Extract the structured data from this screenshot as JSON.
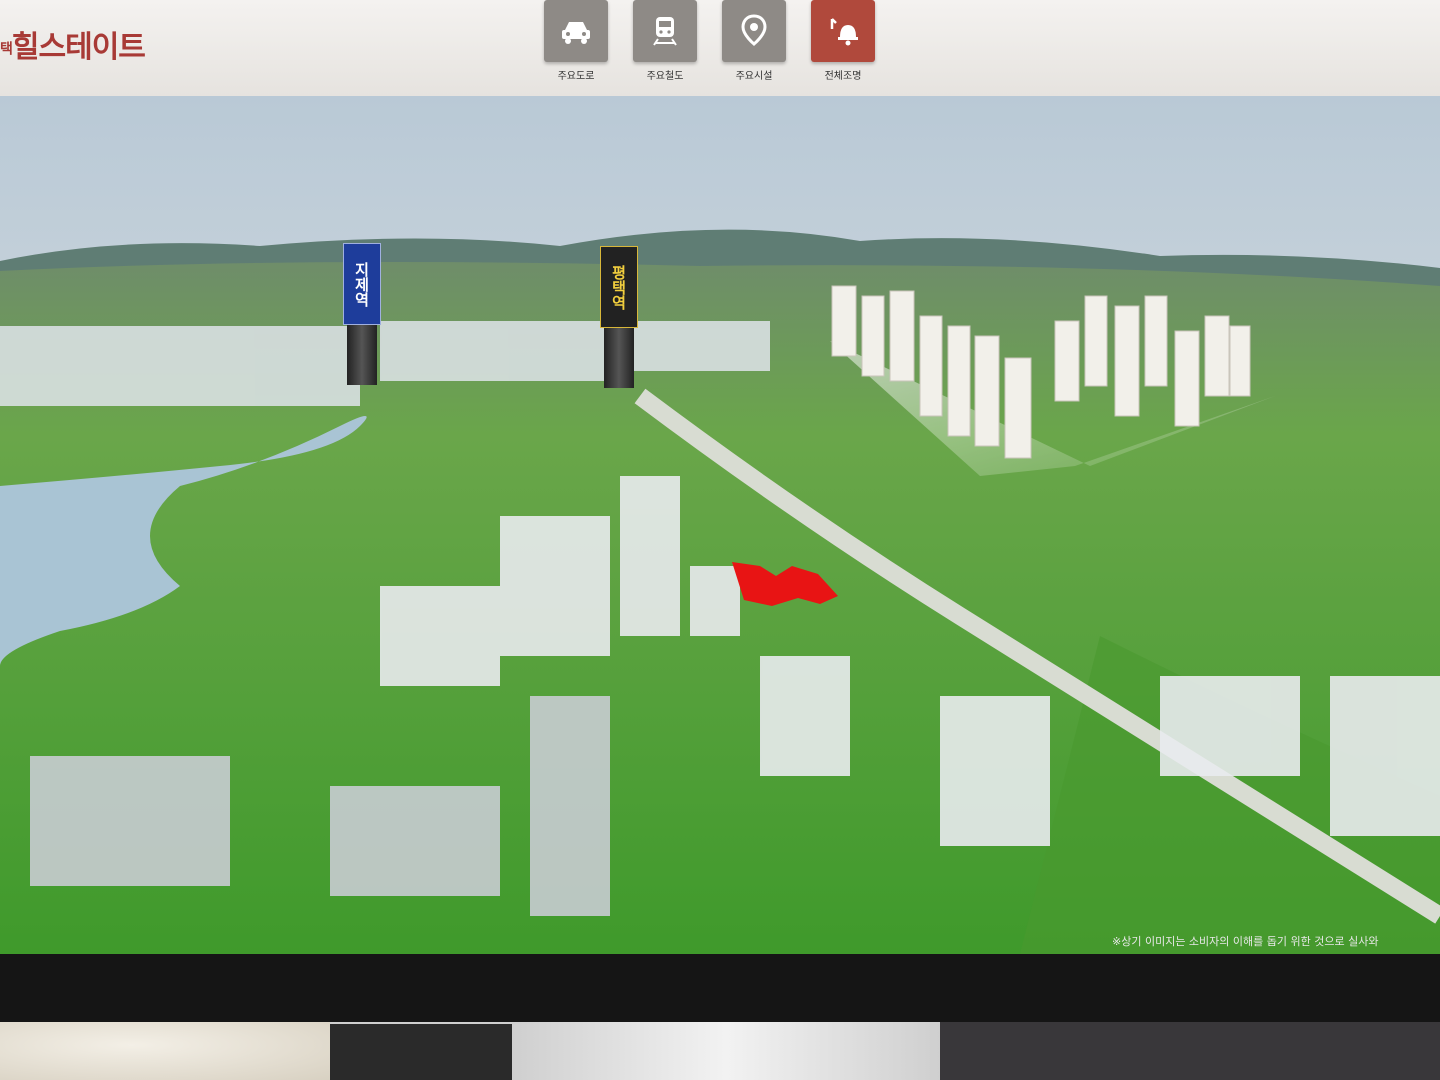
{
  "header": {
    "logo_prefix": "택",
    "logo_text": "힐스테이트"
  },
  "menu": [
    {
      "label": "주요도로",
      "icon": "car-icon",
      "active": false
    },
    {
      "label": "주요철도",
      "icon": "train-icon",
      "active": false
    },
    {
      "label": "주요시설",
      "icon": "location-pin-icon",
      "active": false
    },
    {
      "label": "전체조명",
      "icon": "light-icon",
      "active": true
    }
  ],
  "map": {
    "station_labels": [
      "지제역",
      "평택역"
    ],
    "disclaimer": "※상기 이미지는 소비자의 이해를 돕기 위한 것으로 실사와"
  },
  "colors": {
    "brand": "#a83a36",
    "menu_button": "#8e8a86",
    "menu_active": "#b0493c",
    "site_highlight": "#e81414"
  }
}
